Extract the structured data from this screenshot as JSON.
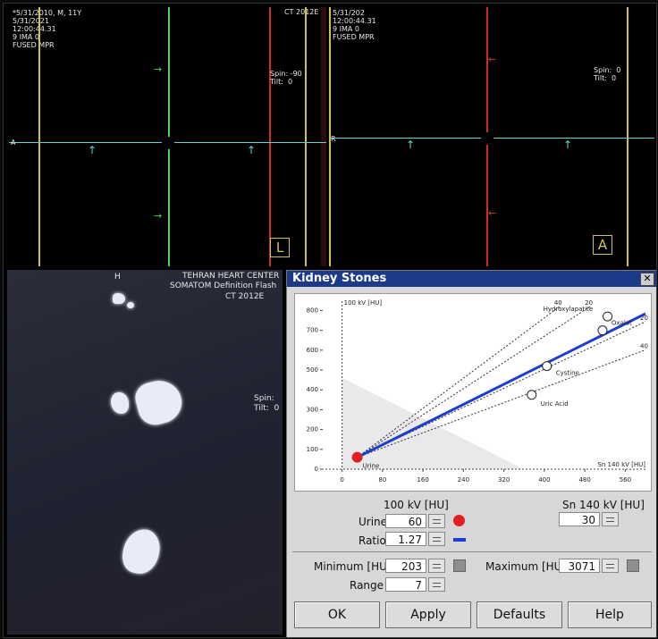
{
  "top_left": {
    "date_line": "*5/31/2010, M, 11Y",
    "info_lines": [
      "5/31/2021",
      "12:00:44.31",
      "9 IMA 0",
      "FUSED MPR"
    ],
    "top_tag": "CT 2012E",
    "spin": "Spin: -90",
    "tilt": "Tilt:  0",
    "orient_left": "A",
    "orient_box": "L"
  },
  "top_right": {
    "date_line": "5/31/202",
    "info_lines": [
      "12:00:44.31",
      "9 IMA 0",
      "FUSED MPR"
    ],
    "spin": "Spin:  0",
    "tilt": "Tilt:  0",
    "orient_left": "R",
    "orient_box": "A"
  },
  "bottom_left": {
    "orient_top": "H",
    "center": "TEHRAN HEART CENTER",
    "scanner": "SOMATOM Definition Flash",
    "model": "CT 2012E",
    "spin": "Spin:",
    "tilt": "Tilt:  0"
  },
  "dialog": {
    "title": "Kidney Stones",
    "close": "✕",
    "y_label": "100 kV [HU]",
    "x_label": "Sn 140 kV [HU]",
    "col_left_header": "100 kV [HU]",
    "col_right_header": "Sn 140 kV [HU]",
    "urine_label": "Urine",
    "urine_100": "60",
    "urine_sn140": "30",
    "ratio_label": "Ratio",
    "ratio_value": "1.27",
    "minimum_label": "Minimum [HU]",
    "minimum_value": "203",
    "maximum_label": "Maximum [HU]",
    "maximum_value": "3071",
    "range_label": "Range",
    "range_value": "7",
    "buttons": {
      "ok": "OK",
      "apply": "Apply",
      "defaults": "Defaults",
      "help": "Help"
    },
    "colors": {
      "urine_dot": "#e02020",
      "ratio_line": "#1a3ed1",
      "title_bar": "#1c3a8a"
    }
  },
  "chart_data": {
    "type": "scatter",
    "xlabel": "Sn 140 kV [HU]",
    "ylabel": "100 kV [HU]",
    "xlim": [
      -40,
      600
    ],
    "ylim": [
      0,
      820
    ],
    "x_ticks": [
      0,
      80,
      160,
      240,
      320,
      400,
      480,
      560
    ],
    "y_ticks": [
      0,
      100,
      200,
      300,
      400,
      500,
      600,
      700,
      800
    ],
    "points": [
      {
        "name": "Urine",
        "x": 30,
        "y": 60
      },
      {
        "name": "Hydroxylapatite",
        "x": 525,
        "y": 770
      },
      {
        "name": "Oxalat",
        "x": 515,
        "y": 700
      },
      {
        "name": "Cystine",
        "x": 405,
        "y": 520
      },
      {
        "name": "Uric Acid",
        "x": 375,
        "y": 375
      }
    ],
    "ratio_line": {
      "slope": 1.27,
      "x_end": 600
    },
    "dashed_lines": [
      {
        "label": "40",
        "slope": 1.9
      },
      {
        "label": "20",
        "slope": 1.65
      },
      {
        "label": "20",
        "slope": 1.2
      },
      {
        "label": "40",
        "slope": 0.95
      }
    ]
  }
}
